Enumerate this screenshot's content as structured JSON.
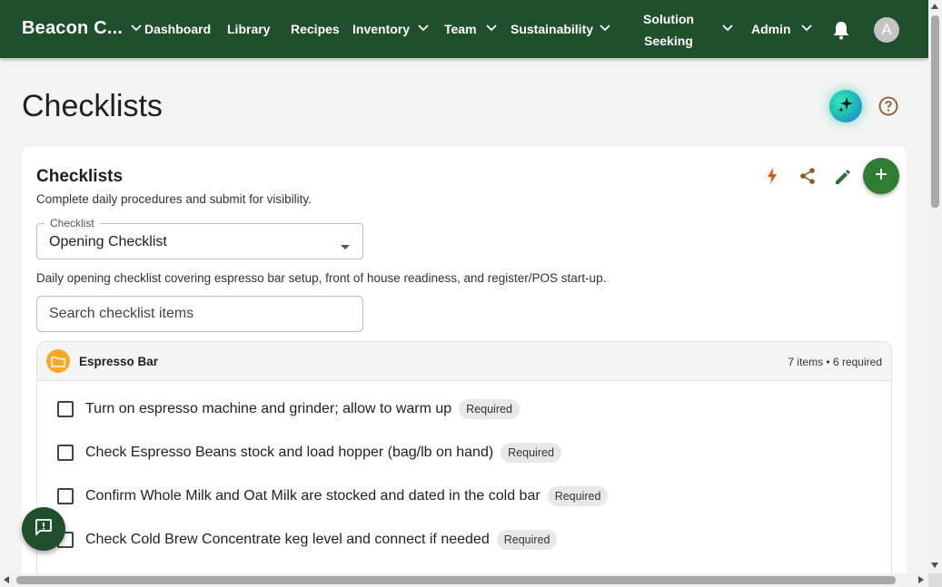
{
  "nav": {
    "brand": "Beacon C...",
    "items": [
      "Dashboard",
      "Library",
      "Recipes",
      "Inventory",
      "Team",
      "Sustainability",
      "Solution",
      "Seeking",
      "Admin"
    ],
    "avatar_initial": "A"
  },
  "page": {
    "title": "Checklists"
  },
  "card": {
    "title": "Checklists",
    "subtitle": "Complete daily procedures and submit for visibility.",
    "select_label": "Checklist",
    "select_value": "Opening Checklist",
    "description": "Daily opening checklist covering espresso bar setup, front of house readiness, and register/POS start-up.",
    "search_placeholder": "Search checklist items"
  },
  "section": {
    "name": "Espresso Bar",
    "count": "7 items • 6 required",
    "items": [
      {
        "text": "Turn on espresso machine and grinder; allow to warm up",
        "tag": "Required"
      },
      {
        "text": "Check Espresso Beans stock and load hopper (bag/lb on hand)",
        "tag": "Required"
      },
      {
        "text": "Confirm Whole Milk and Oat Milk are stocked and dated in the cold bar",
        "tag": "Required"
      },
      {
        "text": "Check Cold Brew Concentrate keg level and connect if needed",
        "tag": "Required"
      }
    ]
  },
  "colors": {
    "topbar": "#1f4f2c",
    "accent_green": "#2e7d32",
    "folder": "#f9a825",
    "bolt": "#e65100",
    "tool_brown": "#8a5a2b"
  },
  "icons": [
    "chevron-down-icon",
    "bell-icon",
    "sparkle-icon",
    "help-icon",
    "bolt-icon",
    "share-icon",
    "edit-icon",
    "plus-icon",
    "folder-icon",
    "feedback-icon"
  ]
}
